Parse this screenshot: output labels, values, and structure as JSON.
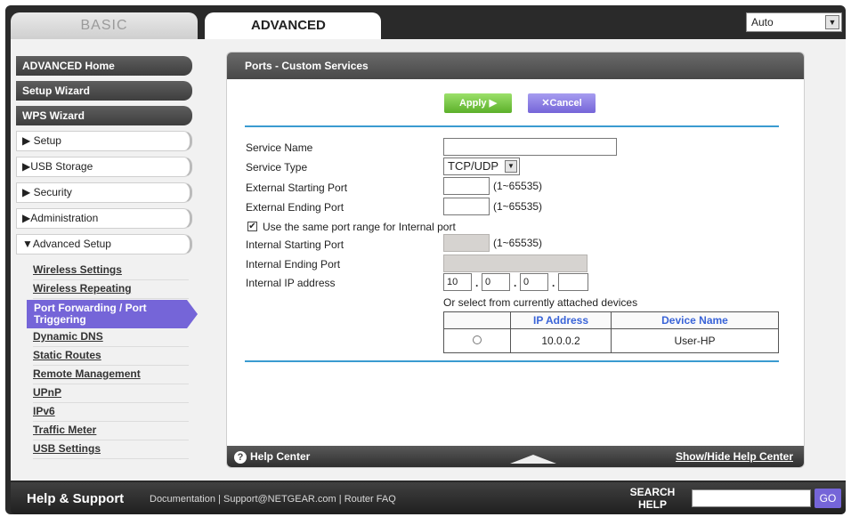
{
  "tabs": {
    "basic": "BASIC",
    "advanced": "ADVANCED"
  },
  "language": {
    "selected": "Auto"
  },
  "sidebar": {
    "advanced_home": "ADVANCED Home",
    "setup_wizard": "Setup Wizard",
    "wps_wizard": "WPS Wizard",
    "setup": "▶ Setup",
    "usb_storage": "▶USB Storage",
    "security": "▶ Security",
    "administration": "▶Administration",
    "advanced_setup": "▼Advanced Setup",
    "sub": [
      "Wireless Settings",
      "Wireless Repeating",
      "Port Forwarding / Port Triggering",
      "Dynamic DNS",
      "Static Routes",
      "Remote Management",
      "UPnP",
      "IPv6",
      "Traffic Meter",
      "USB Settings"
    ]
  },
  "panel": {
    "title": "Ports - Custom Services",
    "apply": "Apply ▶",
    "cancel": "✕Cancel",
    "service_name_label": "Service Name",
    "service_name_value": "",
    "service_type_label": "Service Type",
    "service_type_value": "TCP/UDP",
    "ext_start_label": "External Starting Port",
    "ext_start_value": "",
    "ext_end_label": "External Ending Port",
    "ext_end_value": "",
    "port_range_hint": "(1~65535)",
    "same_range_label": "Use the same port range for Internal port",
    "same_range_checked": "✔",
    "int_start_label": "Internal Starting Port",
    "int_end_label": "Internal Ending Port",
    "int_ip_label": "Internal IP address",
    "ip": [
      "10",
      "0",
      "0",
      ""
    ],
    "ip_dot": ".",
    "select_devices_text": "Or select from currently attached devices",
    "table_headers": [
      "IP Address",
      "Device Name"
    ],
    "table_rows": [
      {
        "ip": "10.0.0.2",
        "name": "User-HP"
      }
    ]
  },
  "help": {
    "center": "Help Center",
    "toggle": "Show/Hide Help Center"
  },
  "footer": {
    "title": "Help & Support",
    "links": [
      "Documentation",
      "Support@NETGEAR.com",
      "Router FAQ"
    ],
    "sep": "|",
    "search_label": "SEARCH HELP",
    "go": "GO"
  },
  "colors": {
    "accent": "#7565d8",
    "apply": "#5cb02a",
    "rule": "#3a9bd0",
    "header_blue": "#3a64d8"
  }
}
